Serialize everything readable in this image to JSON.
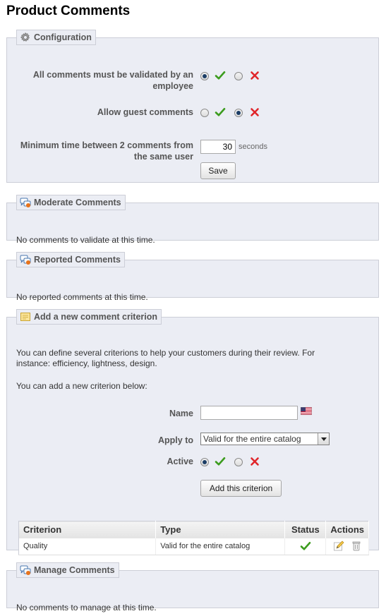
{
  "page": {
    "title": "Product Comments"
  },
  "configuration": {
    "legend": "Configuration",
    "validated_label": "All comments must be validated by an employee",
    "validated_value": "yes",
    "guest_label": "Allow guest comments",
    "guest_value": "no",
    "min_time_label": "Minimum time between 2 comments from the same user",
    "min_time_value": "30",
    "min_time_unit": "seconds",
    "save_label": "Save"
  },
  "moderate": {
    "legend": "Moderate Comments",
    "message": "No comments to validate at this time."
  },
  "reported": {
    "legend": "Reported Comments",
    "message": "No reported comments at this time."
  },
  "criterion": {
    "legend": "Add a new comment criterion",
    "intro": "You can define several criterions to help your customers during their review. For instance: efficiency, lightness, design.",
    "intro2": "You can add a new criterion below:",
    "name_label": "Name",
    "name_value": "",
    "apply_label": "Apply to",
    "apply_value": "Valid for the entire catalog",
    "active_label": "Active",
    "active_value": "yes",
    "add_button": "Add this criterion",
    "table": {
      "headers": [
        "Criterion",
        "Type",
        "Status",
        "Actions"
      ],
      "rows": [
        {
          "criterion": "Quality",
          "type": "Valid for the entire catalog",
          "status": "enabled"
        }
      ]
    }
  },
  "manage": {
    "legend": "Manage Comments",
    "message": "No comments to manage at this time."
  },
  "colors": {
    "box_bg": "#ebedf4",
    "box_border": "#ccced7",
    "check_green": "#3c9c1e",
    "cross_red": "#e0262b"
  },
  "icons": {
    "configuration": "gear-icon",
    "moderate": "comments-icon",
    "reported": "comments-icon",
    "criterion": "note-icon",
    "manage": "comments-icon",
    "yes": "check-icon",
    "no": "cross-icon",
    "flag": "us-flag-icon",
    "edit": "pencil-icon",
    "delete": "trash-icon"
  }
}
